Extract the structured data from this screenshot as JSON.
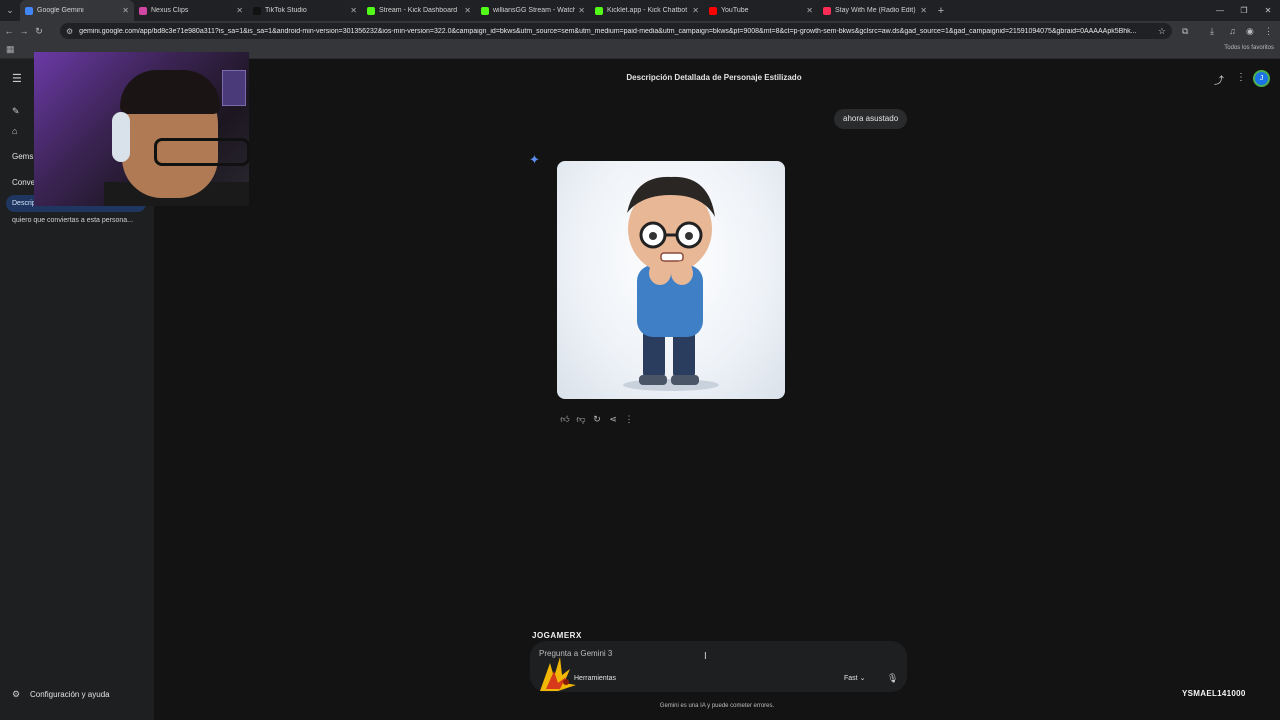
{
  "browser": {
    "tabs": [
      {
        "title": "Google Gemini",
        "color": "#4285f4",
        "active": true
      },
      {
        "title": "Nexus Clips",
        "color": "#d146a3"
      },
      {
        "title": "TikTok Studio",
        "color": "#111111"
      },
      {
        "title": "Stream - Kick Dashboard",
        "color": "#53fc18"
      },
      {
        "title": "williansGG Stream - Watch Live",
        "color": "#53fc18"
      },
      {
        "title": "Kicklet.app - Kick Chatbot and",
        "color": "#53fc18"
      },
      {
        "title": "YouTube",
        "color": "#ff0000"
      },
      {
        "title": "Stay With Me (Radio Edit)",
        "color": "#ff2d55"
      }
    ],
    "url": "gemini.google.com/app/bd8c3e71e980a311?is_sa=1&is_sa=1&android-min-version=301356232&ios-min-version=322.0&campaign_id=bkws&utm_source=sem&utm_medium=paid-media&utm_campaign=bkws&pt=9008&mt=8&ct=p-growth-sem-bkws&gclsrc=aw.ds&gad_source=1&gad_campaignid=21591094075&gbraid=0AAAAApk5Bhk...",
    "bookmarks_label": "Todos los favoritos"
  },
  "sidebar": {
    "gems_label": "Gems",
    "conversations_label": "Conver",
    "active_item": "Descrip",
    "recent_item": "quiero que conviertas a esta persona...",
    "settings_label": "Configuración y ayuda"
  },
  "chat": {
    "title": "Descripción Detallada de Personaje Estilizado",
    "user_message": "ahora asustado",
    "avatar_letter": "J"
  },
  "composer": {
    "placeholder": "Pregunta a Gemini 3",
    "tools_label": "Herramientas",
    "mode_label": "Fast",
    "disclaimer": "Gemini es una IA y puede cometer errores."
  },
  "overlay": {
    "watermark": "JOGAMERX",
    "streamer_tag": "YSMAEL141000"
  }
}
